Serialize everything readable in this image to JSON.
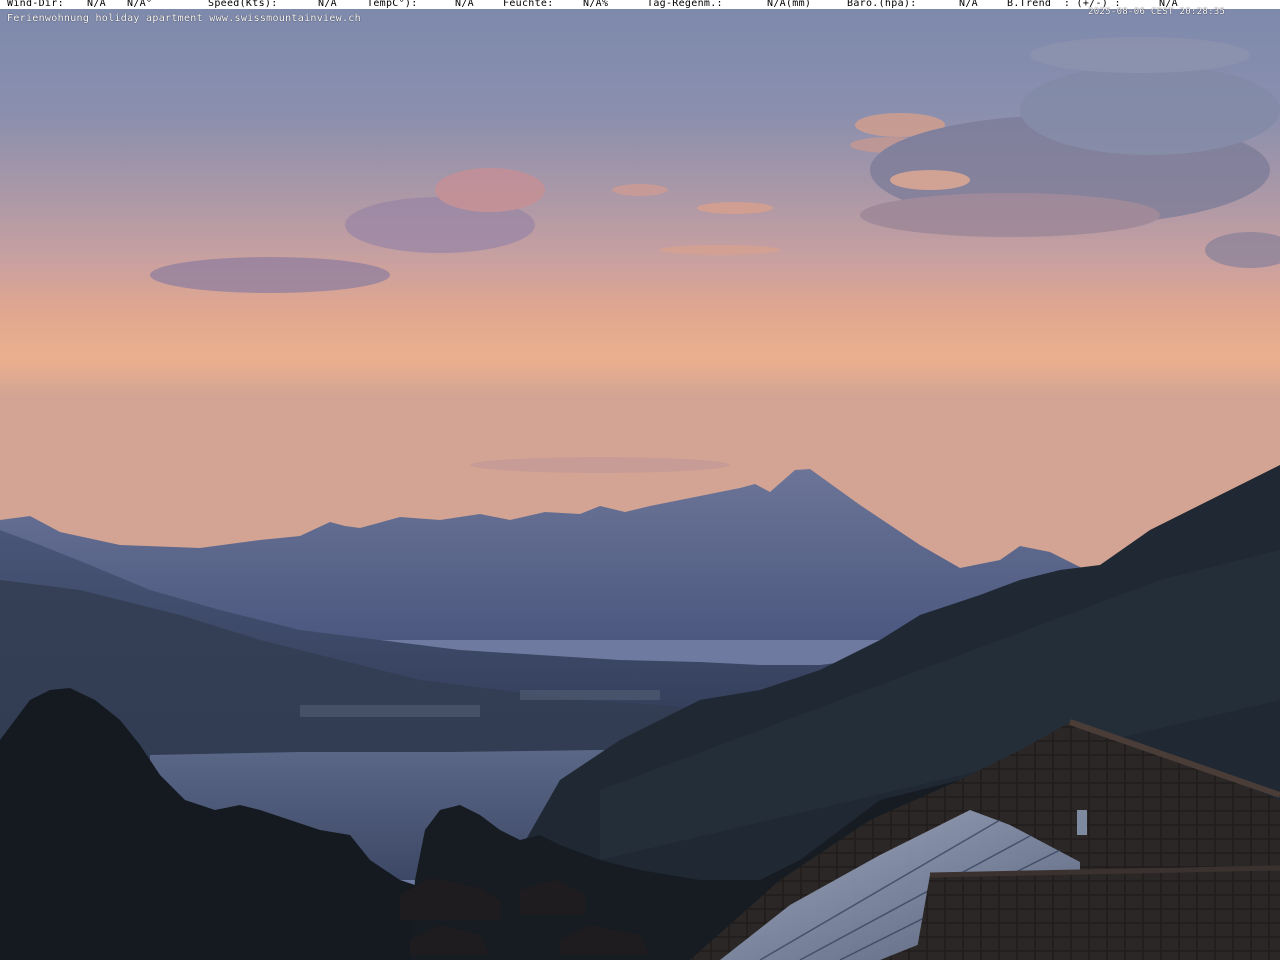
{
  "overlay": {
    "wind_dir_label": "Wind-Dir:",
    "wind_dir_value": "N/A",
    "wind_deg_value": "N/A°",
    "speed_label": "Speed(Kts):",
    "speed_value": "N/A",
    "temp_label": "TempC°):",
    "temp_value": "N/A",
    "feuchte_label": "Feuchte:",
    "feuchte_value": "N/A%",
    "rain_label": "Tag-Regenm.:",
    "rain_value": "N/A(mm)",
    "baro_label": "Baro.(hpa):",
    "baro_value": "N/A",
    "trend_label": "B.Trend  : (+/-) :",
    "trend_value": "N/A",
    "timestamp": "2025-08-06 CEST 20:28:35",
    "caption": "Ferienwohnung holiday apartment www.swissmountainview.ch"
  },
  "colors": {
    "sky_top": "#7d89ac",
    "sky_glow": "#e9ad8f",
    "mountains": "#46527a",
    "foreground": "#141a20"
  }
}
